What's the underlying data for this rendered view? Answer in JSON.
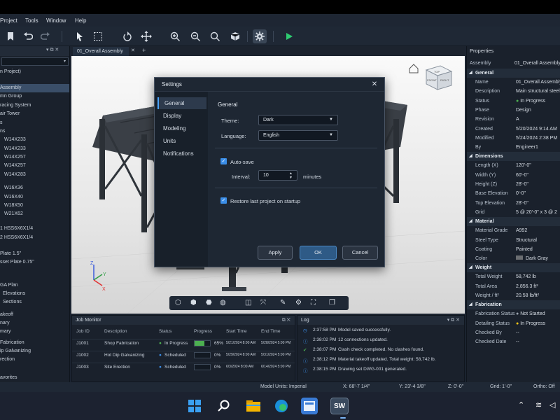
{
  "menu": [
    "Project",
    "Tools",
    "Window",
    "Help"
  ],
  "left_panel": {
    "root": "n Project)",
    "items": [
      "Assembly",
      "mn Group",
      "racing System",
      "air Tower",
      "s",
      "ns",
      "W14X233",
      "W14X233",
      "W14X257",
      "W14X257",
      "W14X283",
      "W16X36",
      "W16X40",
      "W18X50",
      "W21X62",
      "1  HSS6X6X1/4",
      "2  HSS6X6X1/4",
      "Plate 1.5\"",
      "sset Plate 0.75\"",
      "GA Plan",
      "Elevations",
      "Sections",
      "akeoff",
      "nary",
      "mary",
      "Fabrication",
      "ip Galvanizing",
      "rection",
      "avorites"
    ]
  },
  "doc_tab": "01_Overall Assembly",
  "viewcube": {
    "top": "TOP",
    "front": "FRONT",
    "right": "RIGHT"
  },
  "axes": {
    "x": "X",
    "y": "Y",
    "z": "Z"
  },
  "dialog": {
    "title": "Settings",
    "nav": [
      "General",
      "Display",
      "Modeling",
      "Units",
      "Notifications"
    ],
    "section": "General",
    "theme_label": "Theme:",
    "theme_value": "Dark",
    "language_label": "Language:",
    "language_value": "English",
    "autosave_label": "Auto-save",
    "interval_label": "Interval:",
    "interval_value": "10",
    "interval_unit": "minutes",
    "restore_label": "Restore last project on startup",
    "apply": "Apply",
    "ok": "OK",
    "cancel": "Cancel"
  },
  "properties": {
    "title": "Properties",
    "assembly_key": "Assembly",
    "assembly_val": "01_Overall Assembly",
    "sections": [
      {
        "name": "General",
        "rows": [
          [
            "Name",
            "01_Overall Assembly"
          ],
          [
            "Description",
            "Main structural steel"
          ],
          [
            "Status",
            "In Progress"
          ],
          [
            "Phase",
            "Design"
          ],
          [
            "Revision",
            "A"
          ],
          [
            "Created",
            "5/20/2024 9:14 AM"
          ],
          [
            "Modified",
            "5/24/2024 2:38 PM"
          ],
          [
            "By",
            "Engineer1"
          ]
        ]
      },
      {
        "name": "Dimensions",
        "rows": [
          [
            "Length (X)",
            "120'-0\""
          ],
          [
            "Width (Y)",
            "60'-0\""
          ],
          [
            "Height (Z)",
            "28'-0\""
          ],
          [
            "Base Elevation",
            "0'-0\""
          ],
          [
            "Top Elevation",
            "28'-0\""
          ],
          [
            "Grid",
            "5 @ 20'-0\" x 3 @ 2"
          ]
        ]
      },
      {
        "name": "Material",
        "rows": [
          [
            "Material Grade",
            "A992"
          ],
          [
            "Steel Type",
            "Structural"
          ],
          [
            "Coating",
            "Painted"
          ],
          [
            "Color",
            "Dark Gray"
          ]
        ]
      },
      {
        "name": "Weight",
        "rows": [
          [
            "Total Weight",
            "58,742 lb"
          ],
          [
            "Total Area",
            "2,856.3 ft²"
          ],
          [
            "Weight / ft²",
            "20.58 lb/ft²"
          ]
        ]
      },
      {
        "name": "Fabrication",
        "rows": [
          [
            "Fabrication Status",
            "Not Started"
          ],
          [
            "Detailing Status",
            "In Progress"
          ],
          [
            "Checked By",
            "--"
          ],
          [
            "Checked Date",
            "--"
          ]
        ]
      }
    ]
  },
  "job_monitor": {
    "title": "Job Monitor",
    "headers": [
      "Job ID",
      "Description",
      "Status",
      "Progress",
      "Start Time",
      "End Time"
    ],
    "rows": [
      {
        "id": "J1001",
        "desc": "Shop Fabrication",
        "status": "In Progress",
        "progress": 65,
        "progress_label": "65%",
        "start": "5/21/2024 8:00 AM",
        "end": "5/28/2024 5:00 PM",
        "color": "#4caf50"
      },
      {
        "id": "J1002",
        "desc": "Hot Dip Galvanizing",
        "status": "Scheduled",
        "progress": 0,
        "progress_label": "0%",
        "start": "5/29/2024 8:00 AM",
        "end": "5/31/2024 5:00 PM",
        "color": "#3b8ee8"
      },
      {
        "id": "J1003",
        "desc": "Site Erection",
        "status": "Scheduled",
        "progress": 0,
        "progress_label": "0%",
        "start": "6/3/2024 8:00 AM",
        "end": "6/14/2024 5:00 PM",
        "color": "#3b8ee8"
      }
    ]
  },
  "log": {
    "title": "Log",
    "entries": [
      {
        "time": "2:37:58 PM",
        "msg": "Model saved successfully.",
        "icon": "clock-icon"
      },
      {
        "time": "2:38:02 PM",
        "msg": "12 connections updated.",
        "icon": "info-icon"
      },
      {
        "time": "2:38:07 PM",
        "msg": "Clash check completed. No clashes found.",
        "icon": "check-icon"
      },
      {
        "time": "2:38:12 PM",
        "msg": "Material takeoff updated. Total weight: 58,742 lb.",
        "icon": "info-icon"
      },
      {
        "time": "2:38:15 PM",
        "msg": "Drawing set DWG-001 generated.",
        "icon": "info-icon"
      }
    ]
  },
  "statusbar": {
    "units": "Model Units:  Imperial",
    "x": "X:  68'-7 1/4\"",
    "y": "Y:  23'-4 3/8\"",
    "z": "Z:  0'-0\"",
    "grid": "Grid:  1'-0\"",
    "ortho": "Ortho:  Off"
  },
  "taskbar": {
    "sw": "SW"
  },
  "colors": {
    "accent": "#3b8ee8",
    "ok_green": "#4caf50",
    "warn_yellow": "#f2c418",
    "play_green": "#2ecc71"
  }
}
